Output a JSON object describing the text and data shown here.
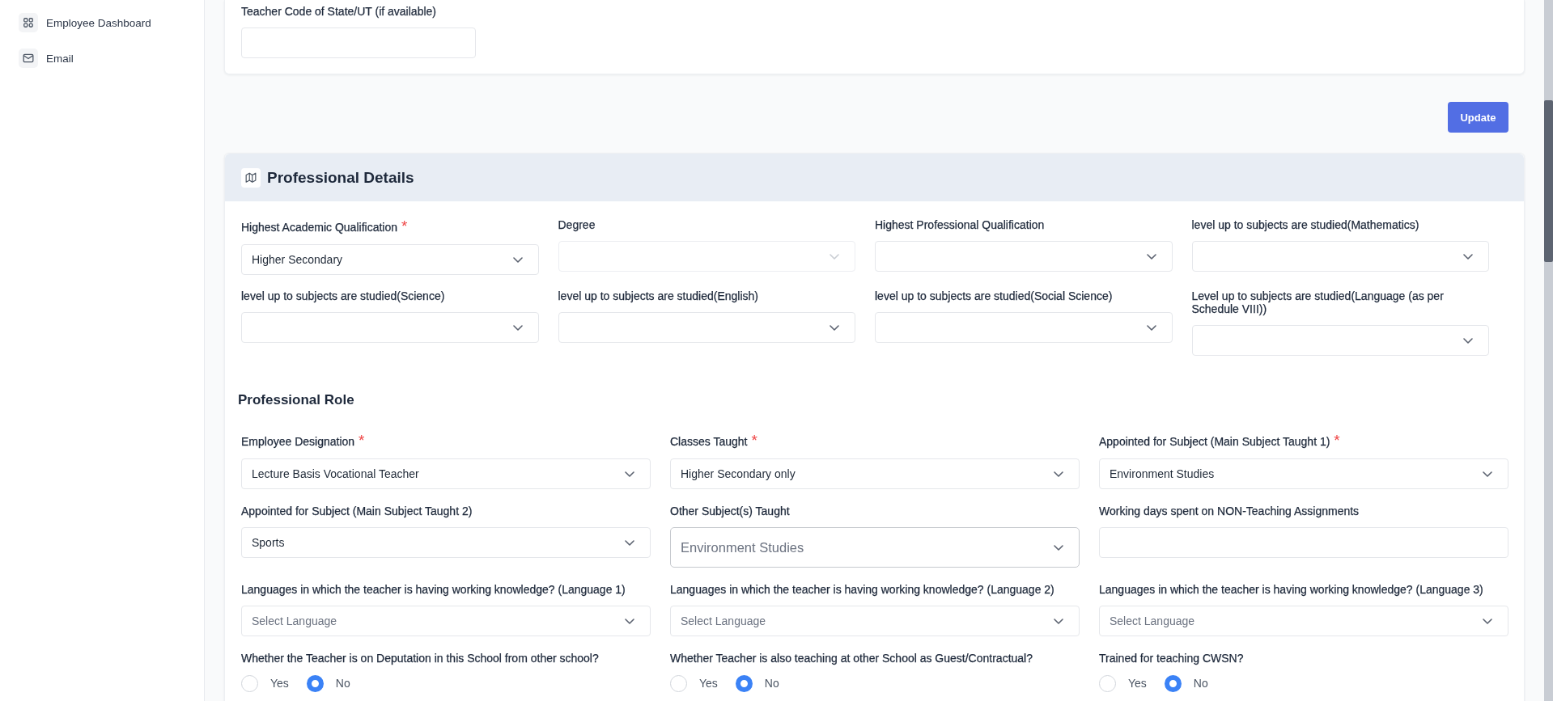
{
  "sidebar": {
    "items": [
      {
        "kind": "dashboard",
        "label": "Employee Dashboard",
        "selected": false
      },
      {
        "kind": "mail",
        "label": "Email",
        "selected": false
      }
    ]
  },
  "identity_card": {
    "fields": [
      {
        "kind": "input",
        "label": "Teacher Code of State/UT (if available)"
      }
    ]
  },
  "update_button": {
    "label": "Update"
  },
  "professional_details": {
    "title": "Professional Details",
    "fields": [
      {
        "kind": "select",
        "label": "Highest Academic Qualification",
        "required_mark": "*",
        "value": "Higher Secondary",
        "disabled": false
      },
      {
        "kind": "select",
        "label": "Degree",
        "disabled": true
      },
      {
        "kind": "select",
        "label": "Highest Professional Qualification",
        "disabled": false
      },
      {
        "kind": "select",
        "label": "level up to subjects are studied(Mathematics)",
        "disabled": false
      },
      {
        "kind": "select",
        "label": "level up to subjects are studied(Science)",
        "disabled": false
      },
      {
        "kind": "select",
        "label": "level up to subjects are studied(English)",
        "disabled": false
      },
      {
        "kind": "select",
        "label": "level up to subjects are studied(Social Science)",
        "disabled": false
      },
      {
        "kind": "select",
        "label": "Level up to subjects are studied(Language (as per Schedule VIII))",
        "disabled": false
      }
    ],
    "role": {
      "title": "Professional Role",
      "fields": [
        {
          "kind": "select",
          "label": "Employee Designation",
          "required_mark": "*",
          "value": "Lecture Basis Vocational Teacher"
        },
        {
          "kind": "select",
          "label": "Classes Taught",
          "required_mark": "*",
          "value": "Higher Secondary only"
        },
        {
          "kind": "select",
          "label": "Appointed for Subject (Main Subject Taught 1)",
          "required_mark": "*",
          "value": "Environment Studies"
        },
        {
          "kind": "select",
          "label": "Appointed for Subject (Main Subject Taught 2)",
          "value": "Sports"
        },
        {
          "kind": "combo",
          "label": "Other Subject(s) Taught",
          "value": "Environment Studies"
        },
        {
          "kind": "input",
          "label": "Working days spent on NON-Teaching Assignments"
        },
        {
          "kind": "select",
          "label": "Languages in which the teacher is having working knowledge? (Language 1)",
          "placeholder": "Select Language"
        },
        {
          "kind": "select",
          "label": "Languages in which the teacher is having working knowledge? (Language 2)",
          "placeholder": "Select Language"
        },
        {
          "kind": "select",
          "label": "Languages in which the teacher is having working knowledge? (Language 3)",
          "placeholder": "Select Language"
        },
        {
          "kind": "radio",
          "label": "Whether the Teacher is on Deputation in this School from other school?",
          "options": [
            {
              "label": "Yes",
              "selected": false
            },
            {
              "label": "No",
              "selected": true
            }
          ]
        },
        {
          "kind": "radio",
          "label": "Whether Teacher is also teaching at other School as Guest/Contractual?",
          "options": [
            {
              "label": "Yes",
              "selected": false
            },
            {
              "label": "No",
              "selected": true
            }
          ]
        },
        {
          "kind": "radio",
          "label": "Trained for teaching CWSN?",
          "options": [
            {
              "label": "Yes",
              "selected": false
            },
            {
              "label": "No",
              "selected": true
            }
          ]
        }
      ]
    }
  }
}
